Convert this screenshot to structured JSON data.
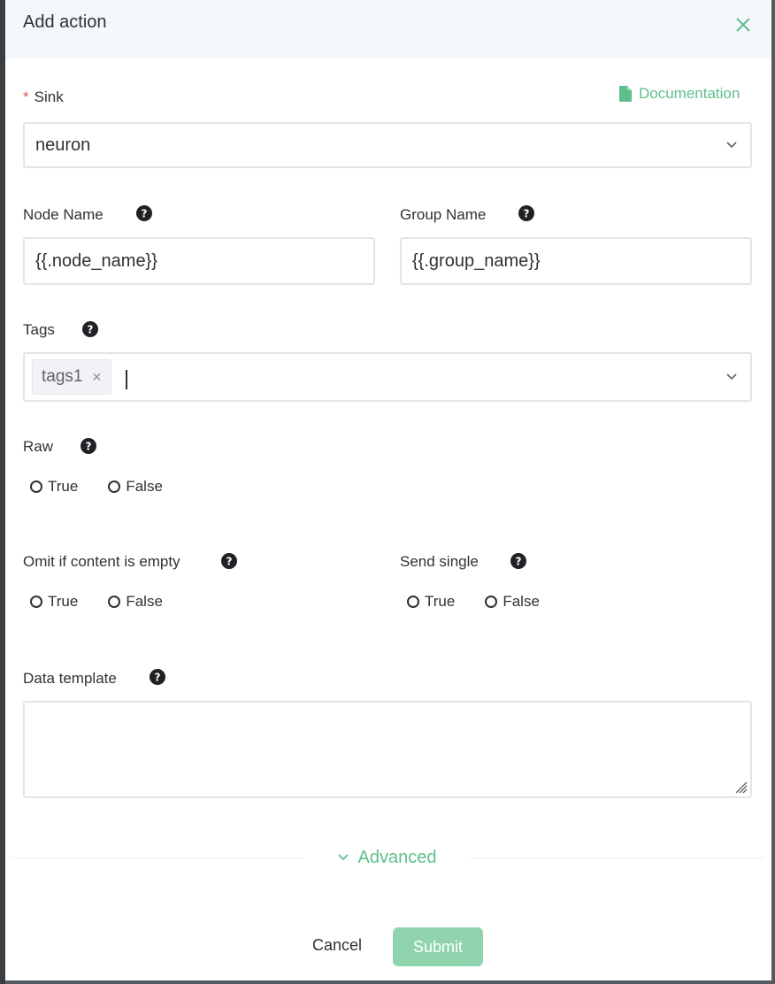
{
  "dialog": {
    "title": "Add action",
    "documentation_label": "Documentation"
  },
  "sink": {
    "label": "Sink",
    "value": "neuron"
  },
  "node_name": {
    "label": "Node Name",
    "value": "{{.node_name}}"
  },
  "group_name": {
    "label": "Group Name",
    "value": "{{.group_name}}"
  },
  "tags": {
    "label": "Tags",
    "items": [
      "tags1"
    ]
  },
  "raw": {
    "label": "Raw",
    "options": [
      "True",
      "False"
    ]
  },
  "omit_if_empty": {
    "label": "Omit if content is empty",
    "options": [
      "True",
      "False"
    ]
  },
  "send_single": {
    "label": "Send single",
    "options": [
      "True",
      "False"
    ]
  },
  "data_template": {
    "label": "Data template",
    "value": ""
  },
  "advanced_label": "Advanced",
  "buttons": {
    "cancel": "Cancel",
    "submit": "Submit"
  },
  "colors": {
    "accent": "#5fbf8a",
    "submit_bg": "#8fd4ad",
    "required": "#e55353",
    "header_bg": "#f4f8fb"
  }
}
